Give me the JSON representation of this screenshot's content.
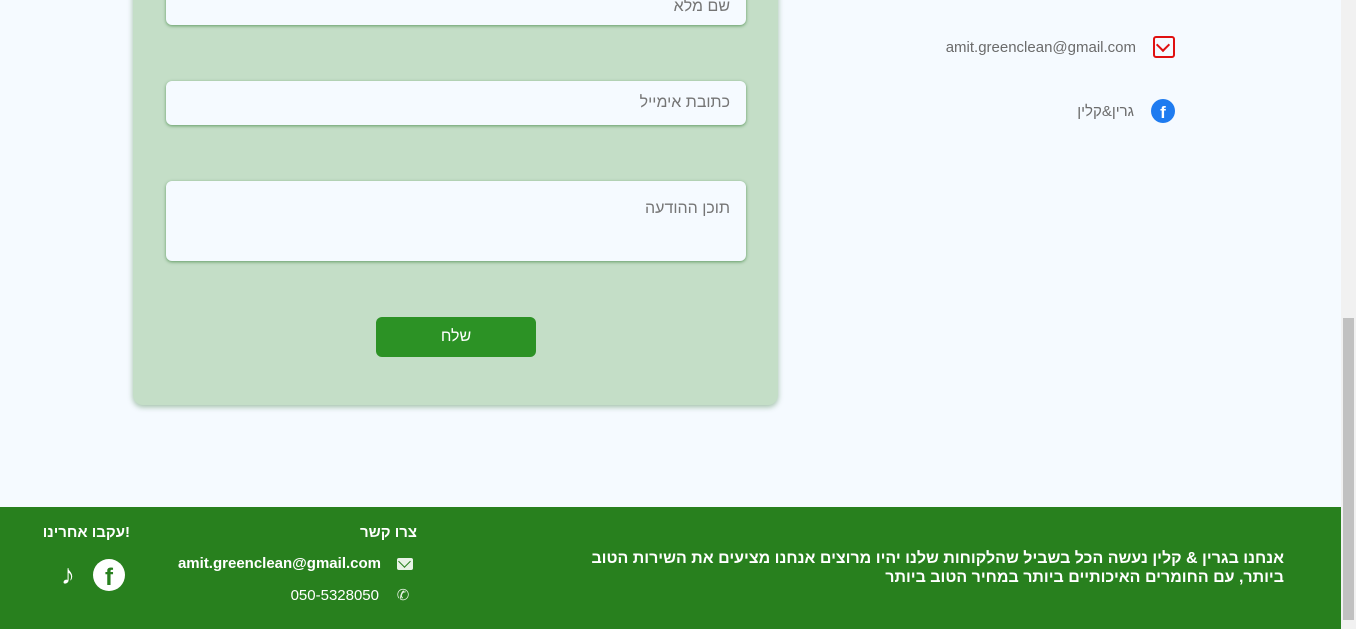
{
  "form": {
    "name_placeholder": "שם מלא",
    "email_placeholder": "כתובת אימייל",
    "message_placeholder": "תוכן ההודעה",
    "send_label": "שלח"
  },
  "contact": {
    "email": "amit.greenclean@gmail.com",
    "facebook": "גרין&קלין",
    "email_icon": "envelope-icon",
    "facebook_icon": "facebook-icon",
    "email_icon_color": "#e01010",
    "facebook_icon_color": "#1e7bf0"
  },
  "footer": {
    "background": "#28801e",
    "about": "אנחנו בגרין & קלין נעשה הכל בשביל שהלקוחות שלנו יהיו מרוצים אנחנו מציעים את השירות הטוב ביותר, עם החומרים האיכותיים ביותר במחיר הטוב ביותר",
    "contact_title": "צרו קשר",
    "email": "amit.greenclean@gmail.com",
    "phone": "050-5328050",
    "follow_title": "עקבו אחרינו!",
    "social_icons": [
      "facebook-icon",
      "tiktok-icon"
    ]
  },
  "accent": "#2c9225"
}
